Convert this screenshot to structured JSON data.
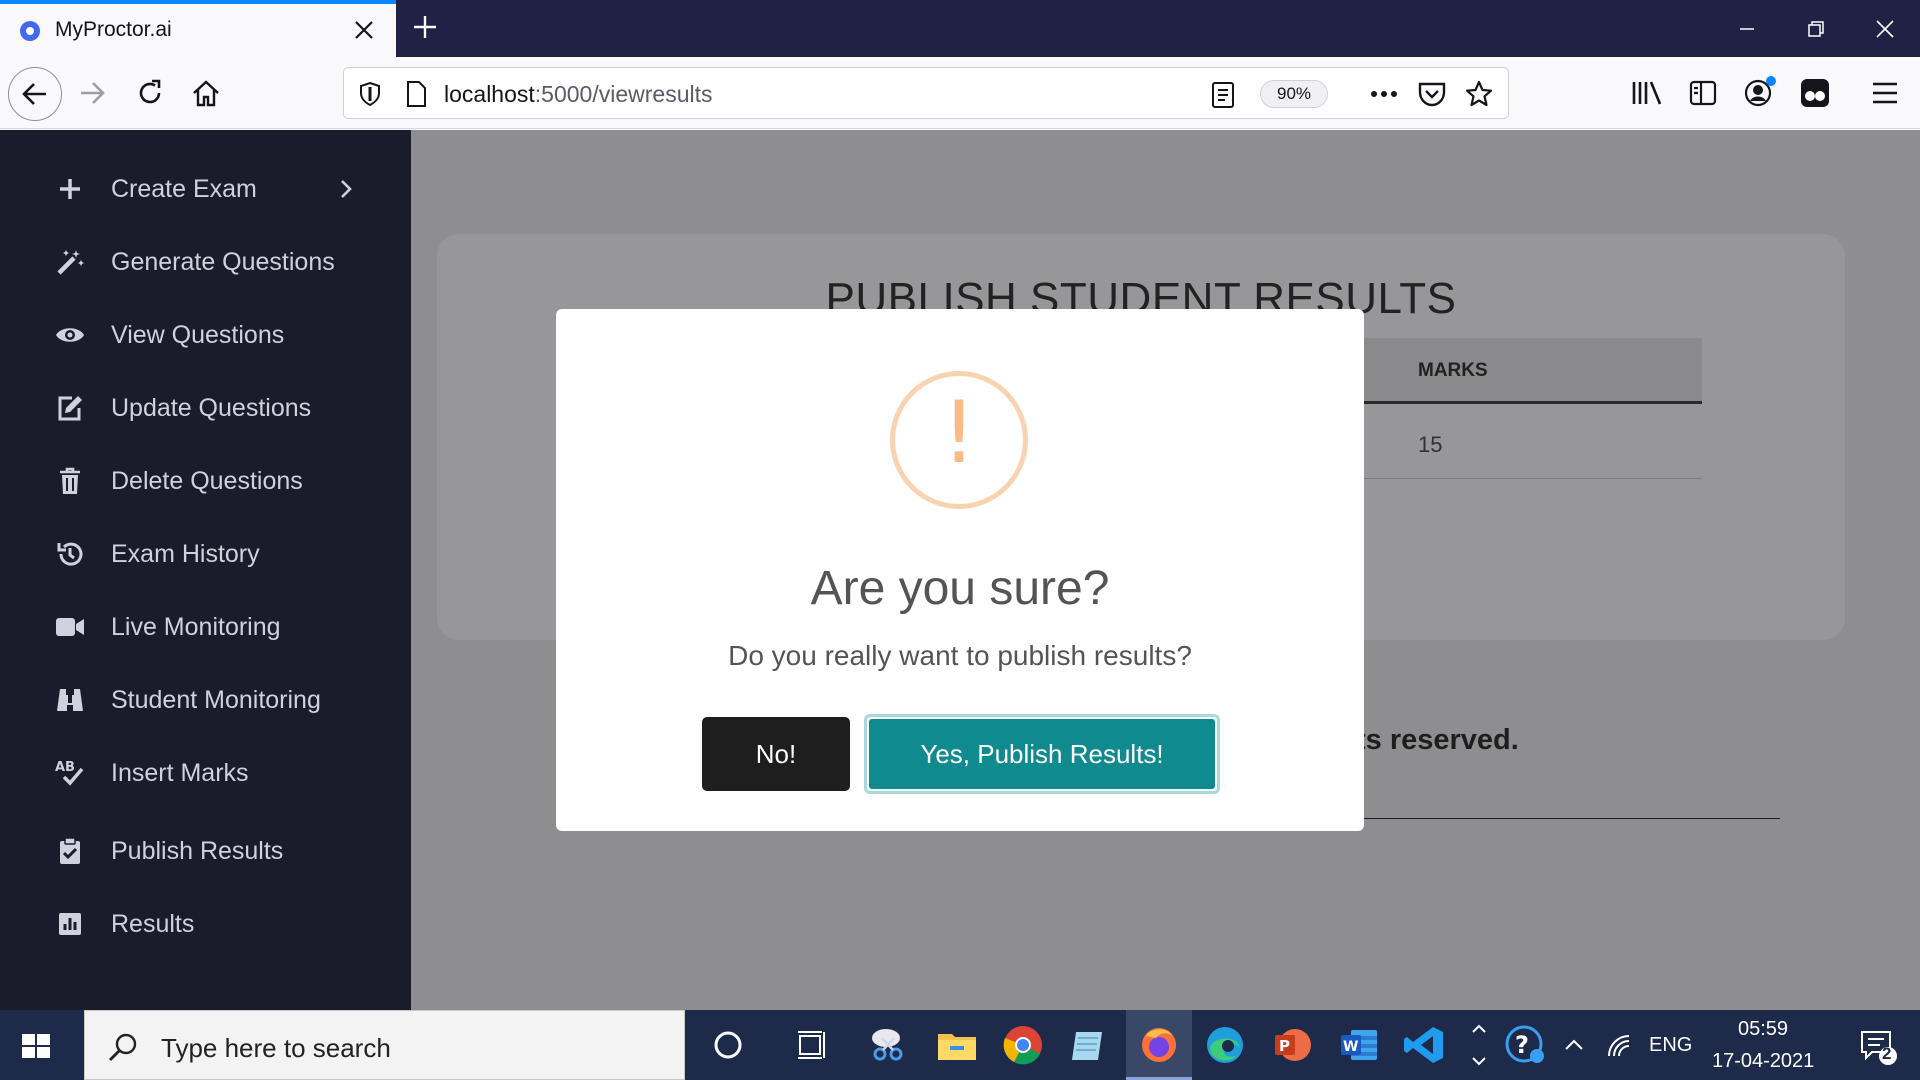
{
  "browser": {
    "tab_title": "MyProctor.ai",
    "url_host": "localhost",
    "url_rest": ":5000/viewresults",
    "zoom": "90%"
  },
  "sidebar": {
    "items": [
      {
        "label": "Create Exam",
        "icon": "plus-icon"
      },
      {
        "label": "Generate Questions",
        "icon": "magic-wand-icon"
      },
      {
        "label": "View Questions",
        "icon": "eye-icon"
      },
      {
        "label": "Update Questions",
        "icon": "edit-icon"
      },
      {
        "label": "Delete Questions",
        "icon": "trash-icon"
      },
      {
        "label": "Exam History",
        "icon": "history-icon"
      },
      {
        "label": "Live Monitoring",
        "icon": "video-camera-icon"
      },
      {
        "label": "Student Monitoring",
        "icon": "binoculars-icon"
      },
      {
        "label": "Insert Marks",
        "icon": "spellcheck-icon"
      },
      {
        "label": "Publish Results",
        "icon": "clipboard-check-icon"
      },
      {
        "label": "Results",
        "icon": "chart-icon"
      }
    ]
  },
  "main": {
    "title": "PUBLISH STUDENT RESULTS",
    "table": {
      "marks_header": "MARKS",
      "marks_value": "15"
    },
    "footer_partial": "ts reserved."
  },
  "modal": {
    "title": "Are you sure?",
    "text": "Do you really want to publish results?",
    "icon_mark": "!",
    "cancel_label": "No!",
    "confirm_label": "Yes, Publish Results!",
    "colors": {
      "confirm": "#0f8a8f",
      "cancel": "#1e1e1f",
      "warning": "#f8bb86"
    }
  },
  "taskbar": {
    "search_placeholder": "Type here to search",
    "language": "ENG",
    "time": "05:59",
    "date": "17-04-2021",
    "notification_count": "2"
  }
}
